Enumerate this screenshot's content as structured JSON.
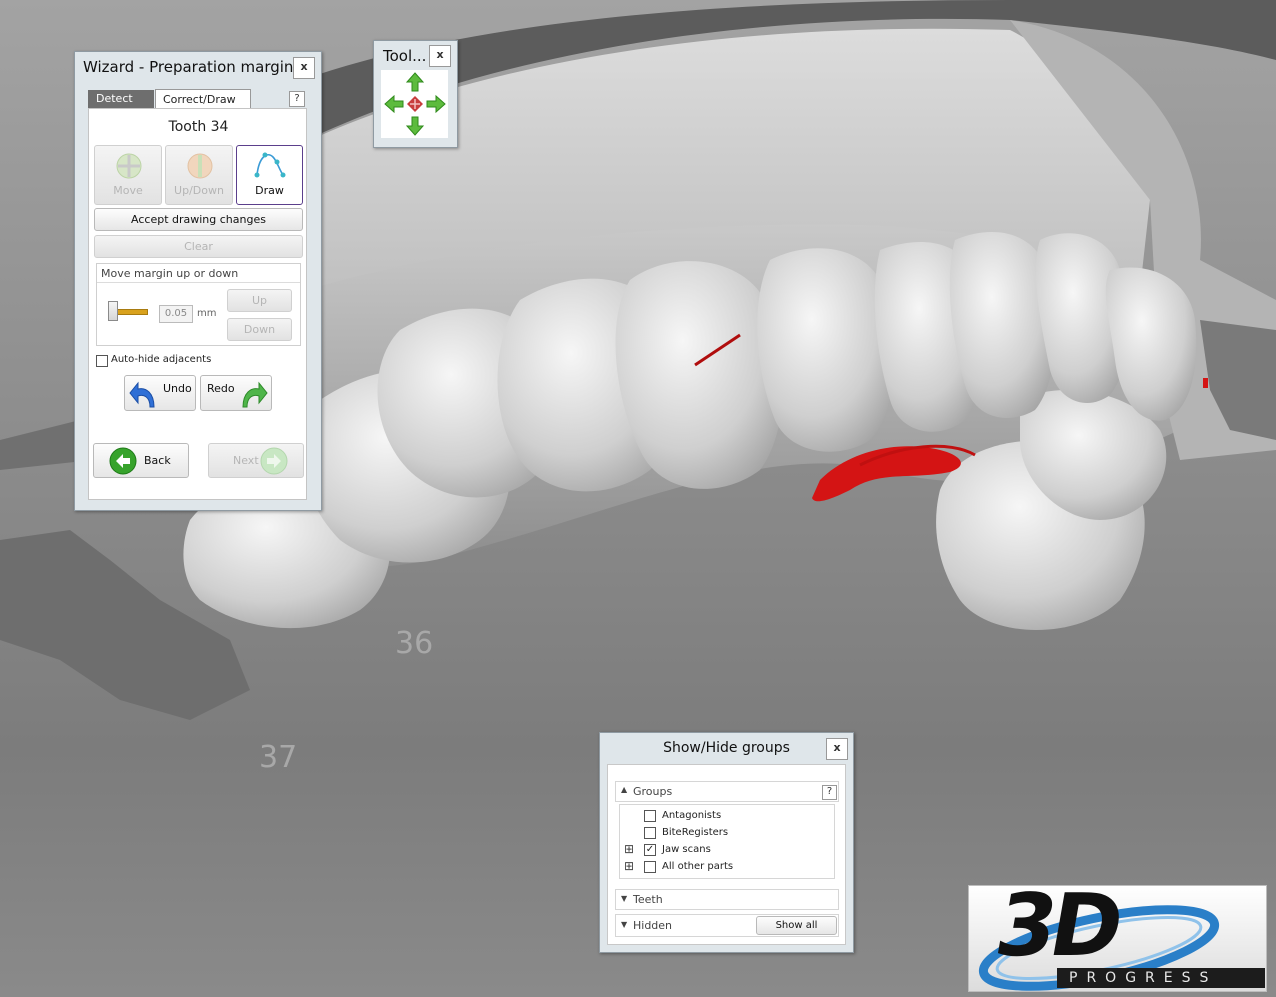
{
  "app": {
    "tooth_label_36": "36",
    "tooth_label_37": "37"
  },
  "wizard": {
    "title": "Wizard - Preparation margin ...",
    "close": "x",
    "tabs": [
      {
        "label": "Detect",
        "active": false
      },
      {
        "label": "Correct/Draw",
        "active": true
      }
    ],
    "help": "?",
    "tooth_title": "Tooth 34",
    "modes": [
      {
        "label": "Move",
        "enabled": false,
        "icon": "move-icon"
      },
      {
        "label": "Up/Down",
        "enabled": false,
        "icon": "updown-icon"
      },
      {
        "label": "Draw",
        "enabled": true,
        "selected": true,
        "icon": "draw-spline-icon"
      }
    ],
    "accept_label": "Accept drawing changes",
    "clear_label": "Clear",
    "move_group_title": "Move margin up or down",
    "step_value": "0.05",
    "unit": "mm",
    "up_label": "Up",
    "down_label": "Down",
    "autohide_label": "Auto-hide adjacents",
    "autohide_checked": false,
    "undo_label": "Undo",
    "redo_label": "Redo",
    "back_label": "Back",
    "next_label": "Next"
  },
  "tool": {
    "title": "Tool...",
    "close": "x"
  },
  "groups": {
    "title": "Show/Hide groups",
    "close": "x",
    "groups_header": "Groups",
    "help": "?",
    "items": [
      {
        "label": "Antagonists",
        "checked": false,
        "expandable": false
      },
      {
        "label": "BiteRegisters",
        "checked": false,
        "expandable": false
      },
      {
        "label": "Jaw scans",
        "checked": true,
        "expandable": true
      },
      {
        "label": "All other parts",
        "checked": false,
        "expandable": true
      }
    ],
    "teeth_header": "Teeth",
    "hidden_header": "Hidden",
    "show_all_label": "Show all"
  },
  "logo": {
    "text": "3D",
    "subtext": "PROGRESS"
  },
  "colors": {
    "accent_purple": "#5b3f8c",
    "panel_bg": "#dfe6ea",
    "margin_red": "#d41414",
    "arrow_green": "#3aa02a"
  }
}
